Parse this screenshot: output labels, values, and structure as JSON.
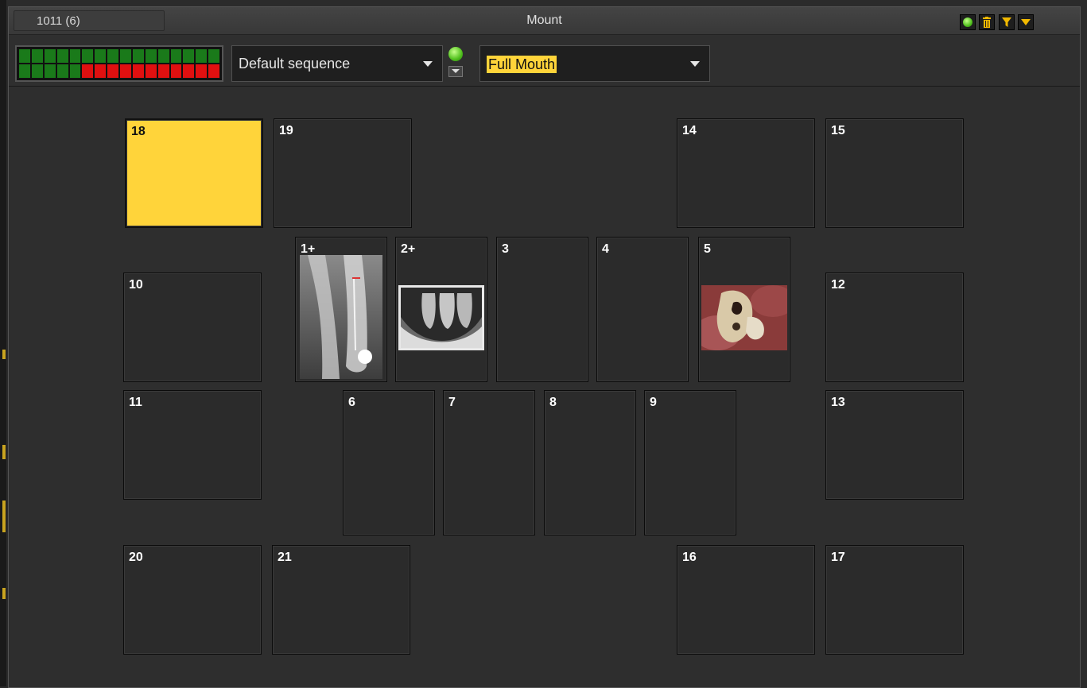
{
  "window": {
    "title": "Mount",
    "record_id": "1011 (6)"
  },
  "title_buttons": [
    {
      "name": "status-light-icon",
      "color": "#5fcf25"
    },
    {
      "name": "trash-icon",
      "color": "#f2b900"
    },
    {
      "name": "filter-icon",
      "color": "#f2b900"
    },
    {
      "name": "chevron-down-icon",
      "color": "#f2b900"
    }
  ],
  "toolbar": {
    "progress": {
      "top_row": "all green",
      "bottom_row_green": 5,
      "bottom_row_red": 11,
      "columns": 16
    },
    "sequence_value": "Default sequence",
    "mount_value": "Full Mouth"
  },
  "slots": [
    {
      "label": "18",
      "selected": true
    },
    {
      "label": "19"
    },
    {
      "label": "14"
    },
    {
      "label": "15"
    },
    {
      "label": "1+",
      "image": "periapical-xray"
    },
    {
      "label": "2+",
      "image": "bitewing-xray"
    },
    {
      "label": "3"
    },
    {
      "label": "4"
    },
    {
      "label": "5",
      "image": "intraoral-photo"
    },
    {
      "label": "10"
    },
    {
      "label": "12"
    },
    {
      "label": "11"
    },
    {
      "label": "6"
    },
    {
      "label": "7"
    },
    {
      "label": "8"
    },
    {
      "label": "9"
    },
    {
      "label": "13"
    },
    {
      "label": "20"
    },
    {
      "label": "21"
    },
    {
      "label": "16"
    },
    {
      "label": "17"
    }
  ],
  "colors": {
    "accent_yellow": "#ffd43a",
    "progress_green": "#1a7a1a",
    "progress_red": "#e01010"
  }
}
